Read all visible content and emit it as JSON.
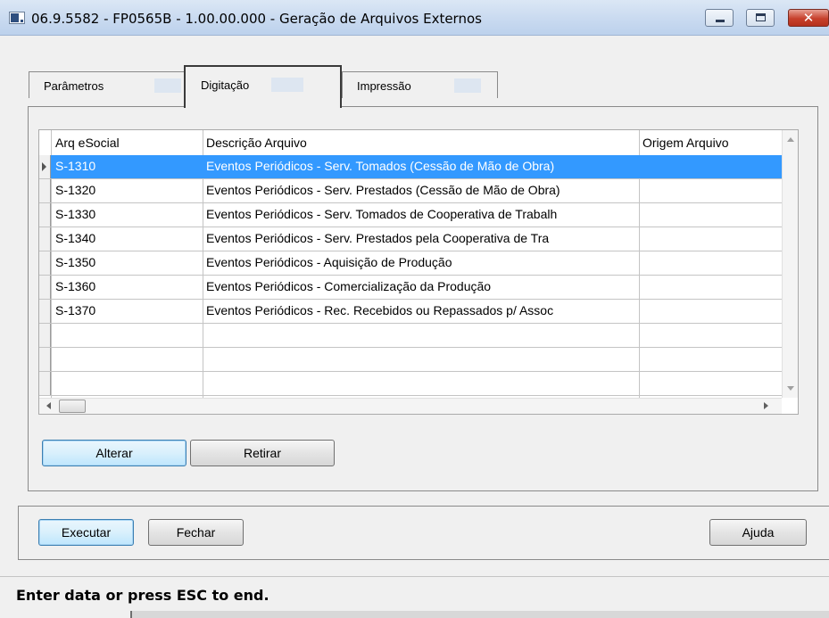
{
  "window": {
    "title": "06.9.5582 - FP0565B - 1.00.00.000 - Geração de Arquivos Externos",
    "close_glyph": "✕",
    "accent_color": "#3399ff"
  },
  "tabs": [
    {
      "label": "Parâmetros",
      "active": false
    },
    {
      "label": "Digitação",
      "active": true
    },
    {
      "label": "Impressão",
      "active": false
    }
  ],
  "grid": {
    "columns": [
      "Arq eSocial",
      "Descrição Arquivo",
      "Origem Arquivo"
    ],
    "rows": [
      {
        "arq": "S-1310",
        "descricao": "Eventos Periódicos - Serv. Tomados (Cessão de Mão de Obra)",
        "origem": "",
        "selected": true
      },
      {
        "arq": "S-1320",
        "descricao": "Eventos Periódicos - Serv. Prestados (Cessão de Mão de Obra)",
        "origem": "",
        "selected": false
      },
      {
        "arq": "S-1330",
        "descricao": "Eventos Periódicos - Serv. Tomados de Cooperativa de Trabalh",
        "origem": "",
        "selected": false
      },
      {
        "arq": "S-1340",
        "descricao": "Eventos Periódicos - Serv. Prestados pela Cooperativa de Tra",
        "origem": "",
        "selected": false
      },
      {
        "arq": "S-1350",
        "descricao": "Eventos Periódicos - Aquisição de Produção",
        "origem": "",
        "selected": false
      },
      {
        "arq": "S-1360",
        "descricao": "Eventos Periódicos - Comercialização da Produção",
        "origem": "",
        "selected": false
      },
      {
        "arq": "S-1370",
        "descricao": "Eventos Periódicos - Rec. Recebidos ou Repassados p/ Assoc",
        "origem": "",
        "selected": false
      },
      {
        "arq": "",
        "descricao": "",
        "origem": "",
        "selected": false
      },
      {
        "arq": "",
        "descricao": "",
        "origem": "",
        "selected": false
      },
      {
        "arq": "",
        "descricao": "",
        "origem": "",
        "selected": false
      },
      {
        "arq": "",
        "descricao": "",
        "origem": "",
        "selected": false
      }
    ]
  },
  "grid_buttons": {
    "alterar": "Alterar",
    "retirar": "Retirar"
  },
  "footer_buttons": {
    "executar": "Executar",
    "fechar": "Fechar",
    "ajuda": "Ajuda"
  },
  "status": {
    "message": "Enter data or press ESC to end."
  }
}
